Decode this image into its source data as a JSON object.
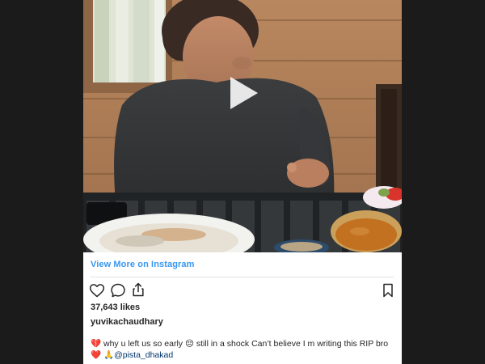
{
  "embed": {
    "view_more_label": "View More on Instagram",
    "likes": "37,643 likes",
    "username": "yuvikachaudhary",
    "caption": {
      "text_start": "💔 why u left us so early 😔 still in a shock Can’t believe I m writing this RIP bro ❤️ 🙏",
      "mention": "@pista_dhakad"
    }
  },
  "icons": {
    "play": "play-icon",
    "like": "heart-icon",
    "comment": "comment-icon",
    "share": "share-icon",
    "save": "bookmark-icon"
  },
  "colors": {
    "background": "#1b1b1b",
    "card": "#ffffff",
    "link_blue": "#3897f0",
    "text": "#262626",
    "mention": "#003569"
  }
}
